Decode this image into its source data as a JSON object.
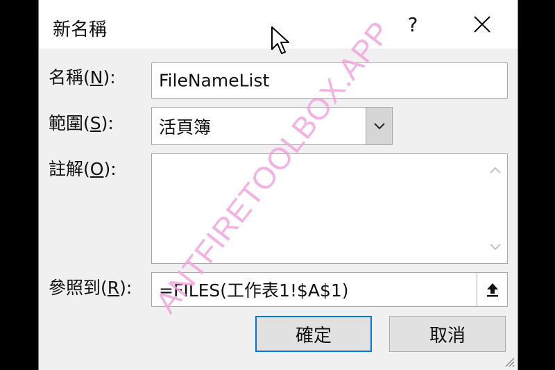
{
  "dialog": {
    "title": "新名稱",
    "help_label": "?",
    "fields": {
      "name": {
        "label_pre": "名稱(",
        "label_key": "N",
        "label_post": "):",
        "value": "FileNameList"
      },
      "scope": {
        "label_pre": "範圍(",
        "label_key": "S",
        "label_post": "):",
        "value": "活頁簿"
      },
      "comment": {
        "label_pre": "註解(",
        "label_key": "O",
        "label_post": "):",
        "value": ""
      },
      "refers_to": {
        "label_pre": "參照到(",
        "label_key": "R",
        "label_post": "):",
        "value": "=FILES(工作表1!$A$1)"
      }
    },
    "buttons": {
      "ok": "確定",
      "cancel": "取消"
    }
  },
  "watermark": "ANTFIRETOOLBOX.APP",
  "colors": {
    "primary_border": "#0078d7",
    "watermark": "#f2a6de"
  }
}
